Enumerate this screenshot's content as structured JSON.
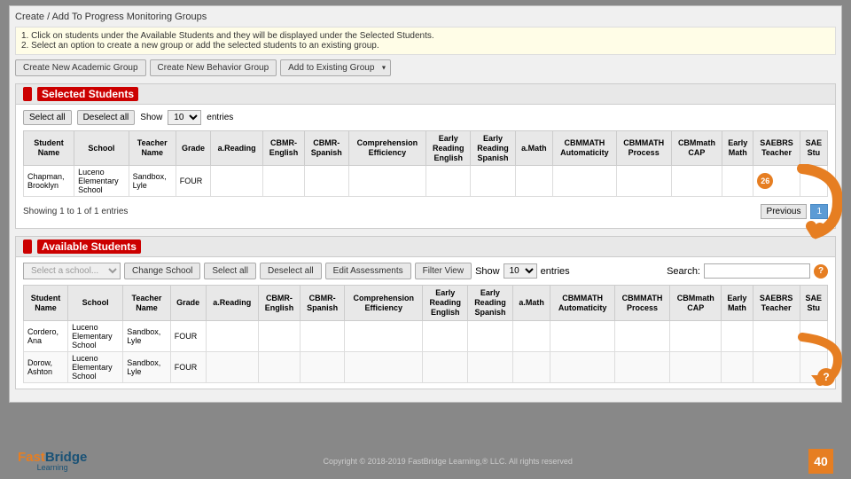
{
  "breadcrumb": "Create / Add To Progress Monitoring Groups",
  "info": {
    "line1": "1. Click on students under the Available Students and they will be displayed under the Selected Students.",
    "line2": "2. Select an option to create a new group or add the selected students to an existing group."
  },
  "action_buttons": {
    "create_academic": "Create New Academic Group",
    "create_behavior": "Create New Behavior Group",
    "add_existing": "Add to Existing Group"
  },
  "selected_section": {
    "header_badge": "",
    "header_label": "Selected Students",
    "select_all": "Select all",
    "deselect_all": "Deselect all",
    "show_label": "Show",
    "entries_label": "entries",
    "entries_value": "10",
    "showing_text": "Showing 1 to 1 of 1 entries",
    "columns": [
      "Student Name",
      "School",
      "Teacher Name",
      "Grade",
      "a.Reading",
      "CBMR-English",
      "CBMR-Spanish",
      "Comprehension Efficiency",
      "Early Reading English",
      "Early Reading Spanish",
      "a.Math",
      "CBMMATH Automaticity",
      "CBMMATH Process",
      "CBMmath CAP",
      "Early Math",
      "SAEBRS Teacher",
      "SAE Stu"
    ],
    "rows": [
      {
        "student_name": "Chapman, Brooklyn",
        "school": "Luceno Elementary School",
        "teacher": "Sandbox, Lyle",
        "grade": "FOUR",
        "badge": "26"
      }
    ],
    "pagination": {
      "previous": "Previous",
      "page": "1"
    }
  },
  "available_section": {
    "header_label": "Available Students",
    "select_school_placeholder": "Select a school...",
    "change_school": "Change School",
    "select_all": "Select all",
    "deselect_all": "Deselect all",
    "edit_assessments": "Edit Assessments",
    "filter_view": "Filter View",
    "show_label": "Show",
    "entries_value": "10",
    "entries_label": "entries",
    "search_label": "Search:",
    "columns": [
      "Student Name",
      "School",
      "Teacher Name",
      "Grade",
      "a.Reading",
      "CBMR-English",
      "CBMR-Spanish",
      "Comprehension Efficiency",
      "Early Reading English",
      "Early Reading Spanish",
      "a.Math",
      "CBMMATH Automaticity",
      "CBMMATH Process",
      "CBMmath CAP",
      "Early Math",
      "SAEBRS Teacher",
      "SAE Stu"
    ],
    "rows": [
      {
        "student_name": "Cordero, Ana",
        "school": "Luceno Elementary School",
        "teacher": "Sandbox, Lyle",
        "grade": "FOUR"
      },
      {
        "student_name": "Dorow, Ashton",
        "school": "Luceno Elementary School",
        "teacher": "Sandbox, Lyle",
        "grade": "FOUR"
      }
    ]
  },
  "footer": {
    "copyright": "Copyright © 2018-2019 FastBridge Learning,®  LLC.  All rights reserved",
    "brand_fast": "Fast",
    "brand_bridge": "Bridge",
    "brand_learning": "Learning",
    "page_number": "40"
  }
}
